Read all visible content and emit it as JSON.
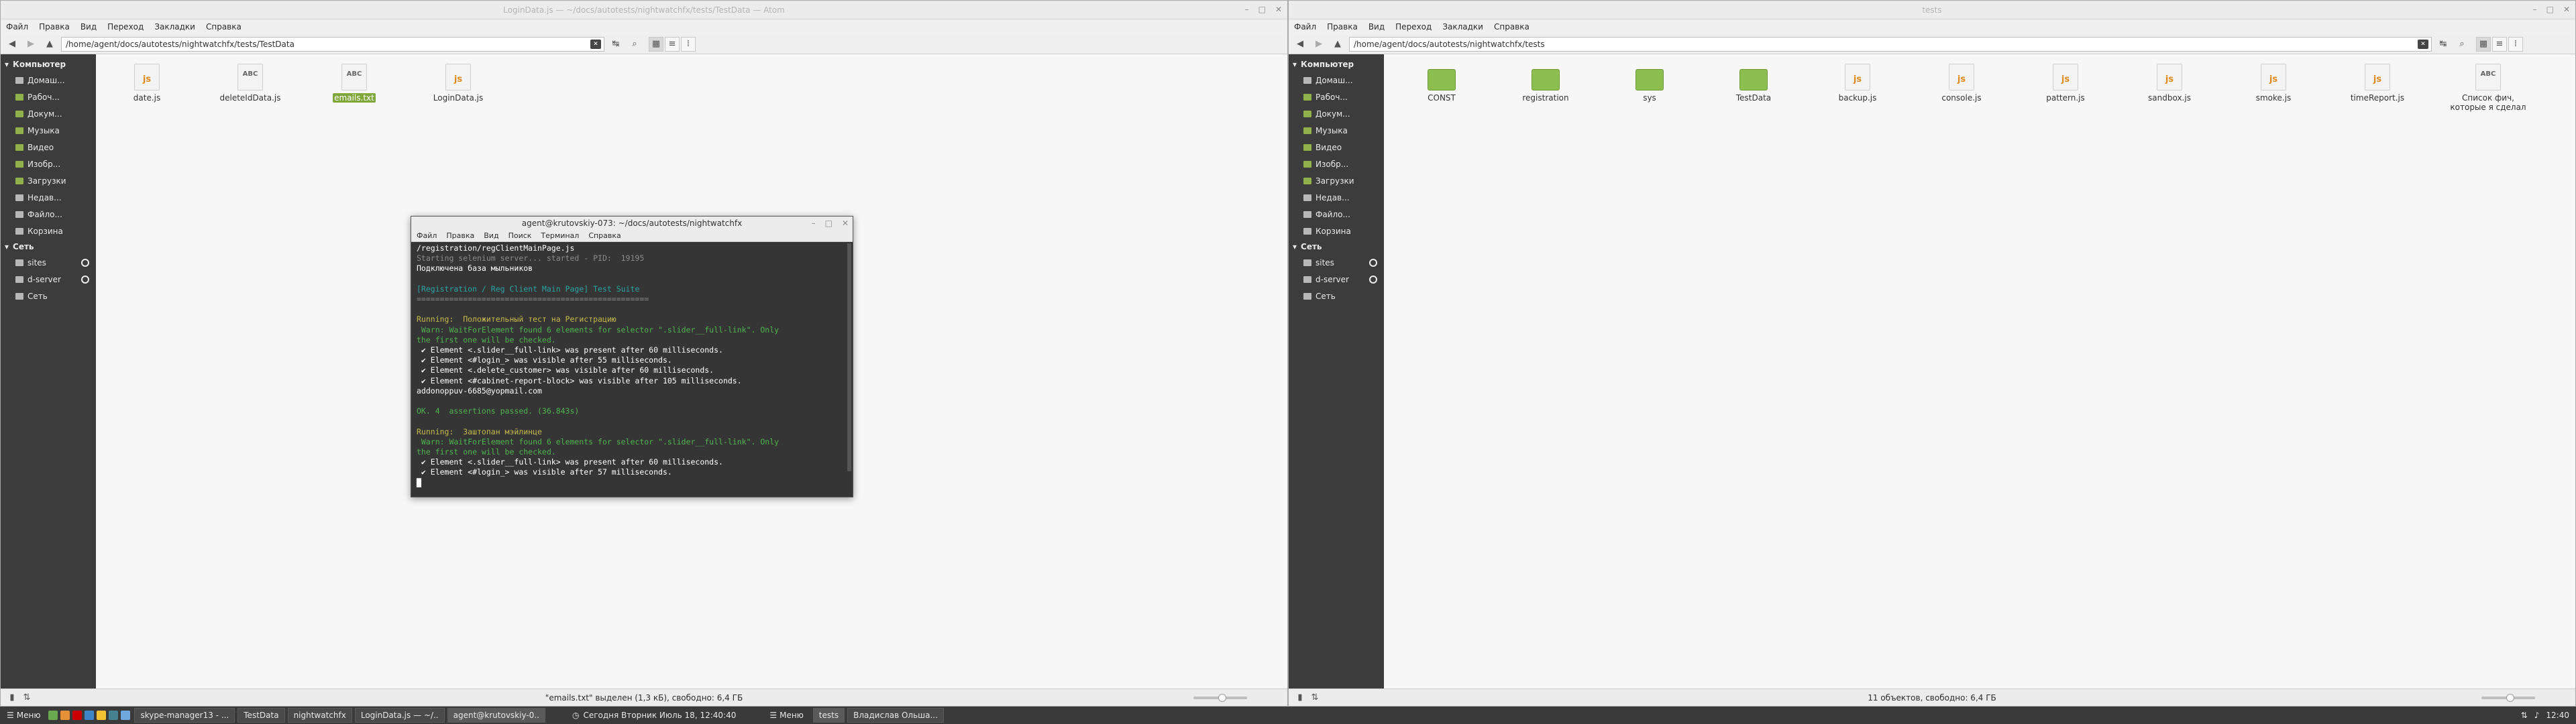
{
  "left": {
    "title": "LoginData.js — ~/docs/autotests/nightwatchfx/tests/TestData — Atom",
    "menu": [
      "Файл",
      "Правка",
      "Вид",
      "Переход",
      "Закладки",
      "Справка"
    ],
    "path": "/home/agent/docs/autotests/nightwatchfx/tests/TestData",
    "files": [
      {
        "name": "date.js",
        "type": "js"
      },
      {
        "name": "deleteIdData.js",
        "type": "txt"
      },
      {
        "name": "emails.txt",
        "type": "txt",
        "selected": true
      },
      {
        "name": "LoginData.js",
        "type": "js"
      }
    ],
    "status": "\"emails.txt\" выделен (1,3 кБ), свободно: 6,4 ГБ",
    "zoom_fraction": 0.55
  },
  "right": {
    "title": "tests",
    "menu": [
      "Файл",
      "Правка",
      "Вид",
      "Переход",
      "Закладки",
      "Справка"
    ],
    "path": "/home/agent/docs/autotests/nightwatchfx/tests",
    "files": [
      {
        "name": "CONST",
        "type": "folder"
      },
      {
        "name": "registration",
        "type": "folder"
      },
      {
        "name": "sys",
        "type": "folder"
      },
      {
        "name": "TestData",
        "type": "folder"
      },
      {
        "name": "backup.js",
        "type": "js"
      },
      {
        "name": "console.js",
        "type": "js"
      },
      {
        "name": "pattern.js",
        "type": "js"
      },
      {
        "name": "sandbox.js",
        "type": "js"
      },
      {
        "name": "smoke.js",
        "type": "js"
      },
      {
        "name": "timeReport.js",
        "type": "js"
      },
      {
        "name": "Список фич, которые я сделал",
        "type": "txt"
      }
    ],
    "status": "11 объектов, свободно: 6,4 ГБ",
    "zoom_fraction": 0.55
  },
  "sidebar": {
    "computer_header": "Компьютер",
    "computer_items": [
      "Домаш...",
      "Рабоч...",
      "Докум...",
      "Музыка",
      "Видео",
      "Изобр...",
      "Загрузки",
      "Недав...",
      "Файло...",
      "Корзина"
    ],
    "network_header": "Сеть",
    "network_items": [
      "sites",
      "d-server",
      "Сеть"
    ]
  },
  "terminal": {
    "title": "agent@krutovskiy-073: ~/docs/autotests/nightwatchfx",
    "menu": [
      "Файл",
      "Правка",
      "Вид",
      "Поиск",
      "Терминал",
      "Справка"
    ],
    "lines": [
      {
        "t": "/registration/regClientMainPage.js",
        "c": ""
      },
      {
        "t": "Starting selenium server... started - PID:  19195",
        "c": "dim"
      },
      {
        "t": "Подключена база мыльников",
        "c": ""
      },
      {
        "t": "",
        "c": ""
      },
      {
        "t": "[Registration / Reg Client Main Page] Test Suite",
        "c": "teal"
      },
      {
        "t": "==================================================",
        "c": "dim"
      },
      {
        "t": "",
        "c": ""
      },
      {
        "t": "Running:  Положительный тест на Регистрацию",
        "c": "yel"
      },
      {
        "t": " Warn: WaitForElement found 6 elements for selector \".slider__full-link\". Only",
        "c": "green"
      },
      {
        "t": "the first one will be checked.",
        "c": "green"
      },
      {
        "t": " ✔ Element <.slider__full-link> was present after 60 milliseconds.",
        "c": ""
      },
      {
        "t": " ✔ Element <#login_> was visible after 55 milliseconds.",
        "c": ""
      },
      {
        "t": " ✔ Element <.delete_customer> was visible after 60 milliseconds.",
        "c": ""
      },
      {
        "t": " ✔ Element <#cabinet-report-block> was visible after 105 milliseconds.",
        "c": ""
      },
      {
        "t": "addonoppuv-6685@yopmail.com",
        "c": ""
      },
      {
        "t": "",
        "c": ""
      },
      {
        "t": "OK. 4  assertions passed. (36.843s)",
        "c": "green"
      },
      {
        "t": "",
        "c": ""
      },
      {
        "t": "Running:  Заштопан мэйлинце",
        "c": "yel"
      },
      {
        "t": " Warn: WaitForElement found 6 elements for selector \".slider__full-link\". Only",
        "c": "green"
      },
      {
        "t": "the first one will be checked.",
        "c": "green"
      },
      {
        "t": " ✔ Element <.slider__full-link> was present after 60 milliseconds.",
        "c": ""
      },
      {
        "t": " ✔ Element <#login_> was visible after 57 milliseconds.",
        "c": ""
      },
      {
        "t": "█",
        "c": ""
      }
    ]
  },
  "taskbar": {
    "menu_label": "Меню",
    "windows_left": [
      "skype-manager13 - ...",
      "TestData",
      "nightwatchfx",
      "LoginData.js — ~/..",
      "agent@krutovskiy-0.."
    ],
    "clock_text": "Сегодня Вторник Июль 18, 12:40:40",
    "menu_label_right": "Меню",
    "windows_right": [
      "tests",
      "Владислав Ольша..."
    ],
    "time": "12:40"
  }
}
